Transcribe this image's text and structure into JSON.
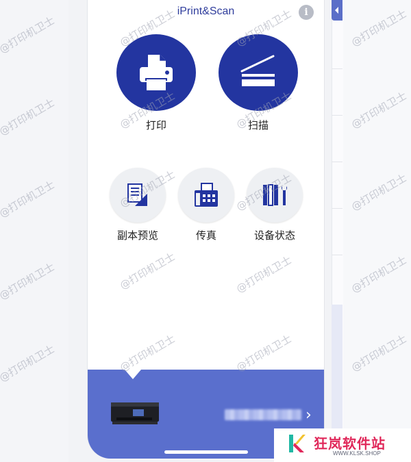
{
  "app": {
    "title": "iPrint&Scan"
  },
  "main_actions": [
    {
      "label": "打印",
      "icon": "printer-icon"
    },
    {
      "label": "扫描",
      "icon": "scanner-icon"
    }
  ],
  "secondary_actions": [
    {
      "label": "副本预览",
      "icon": "copy-preview-icon"
    },
    {
      "label": "传真",
      "icon": "fax-icon"
    },
    {
      "label": "设备状态",
      "icon": "device-status-icon"
    }
  ],
  "device_bar": {
    "device_name_redacted": true
  },
  "watermark": {
    "text": "@打印机卫士"
  },
  "brand": {
    "name": "狂岚软件站",
    "url": "WWW.KLSK.SHOP"
  },
  "colors": {
    "primary": "#2335a0",
    "bar": "#5a6fcd",
    "title": "#2f3d9c"
  }
}
